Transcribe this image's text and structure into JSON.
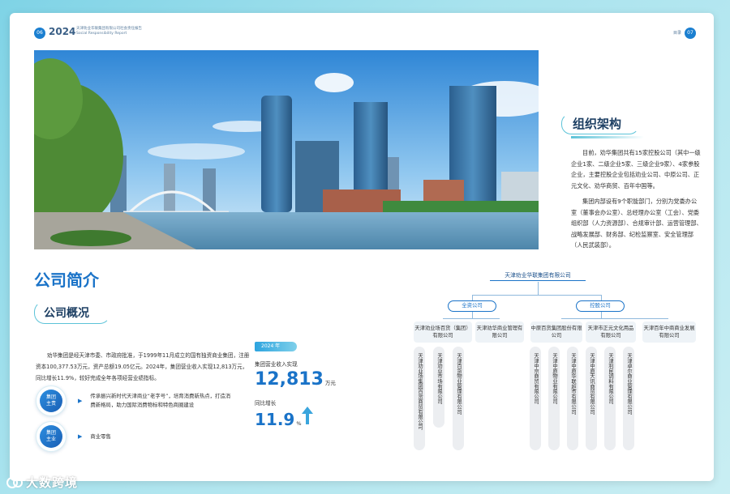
{
  "header": {
    "page_left": "06",
    "year": "2024",
    "report_title": "天津劝业华联集团有限公司社会责任报告",
    "report_sub": "Social Responsibility Report",
    "right_text": "目录",
    "page_right": "07"
  },
  "org": {
    "heading": "组织架构",
    "p1": "目前，劝华集团共有15家控股公司（其中一级企业1家、二级企业5家、三级企业9家）、4家参股企业，主要控股企业包括劝业公司、中原公司、正元文化、劝华商贸、百年中国等。",
    "p2": "集团内部设有9个职能部门，分别为党委办公室（董事会办公室）、总经理办公室（工会）、党委组织部（人力资源部）、合规审计部、运营管理部、战略发展部、财务部、纪检监察室、安全管理部（人民武装部）。"
  },
  "intro": {
    "title": "公司简介",
    "sub": "公司概况",
    "paragraph": "劝华集团是经天津市委、市政府批准，于1999年11月成立的国有独资商业集团，注册资本100,377.53万元，资产总额19.05亿元。2024年，集团营业收入实现12,813万元，同比增长11.9%，较好完成全年各项经营业绩指标。",
    "pills": [
      {
        "label": "集团\n主责",
        "text": "传承振兴新时代天津商业“老字号”，培育消费新热点，打造消费新格局，助力国际消费物标和特色商圈建设"
      },
      {
        "label": "集团\n主业",
        "text": "商业零售"
      }
    ]
  },
  "stats": {
    "year_tag": "2024 年",
    "revenue_label": "集团营业收入实现",
    "revenue_value": "12,813",
    "revenue_unit": "万元",
    "growth_label": "同比增长",
    "growth_value": "11.9",
    "growth_unit": "%"
  },
  "chart": {
    "root": "天津劝业华联集团有限公司",
    "groups": [
      "全资公司",
      "控股公司"
    ],
    "boxes": [
      "天津劝业场百货（集团）有限公司",
      "天津劝华商业管理有限公司",
      "中原百货集团股份有限公司",
      "天津市正元文化用品有限公司",
      "天津百年中商商业发展有限公司"
    ],
    "verticals": [
      "天津劝业场集团百货商贸有限公司",
      "天津劝业市场有限公司",
      "天津百货物业管理有限公司",
      "天津中京商贸有限公司",
      "天津中原物业有限公司",
      "天津中原华联超市有限公司",
      "天津中原天讯商贸有限公司",
      "天津利民调料有限公司",
      "天津卓尔商业管理有限公司"
    ]
  },
  "watermark": "大数跨境"
}
